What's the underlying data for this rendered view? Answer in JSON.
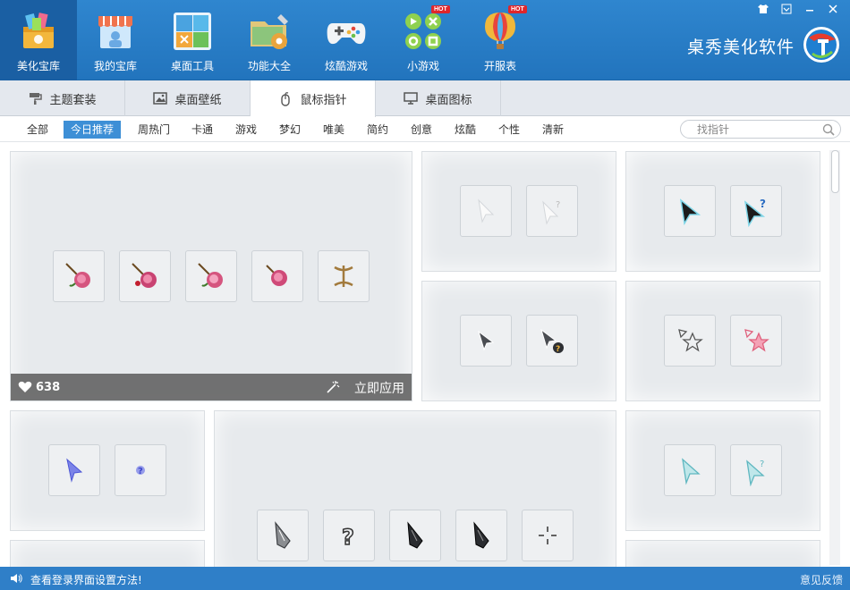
{
  "nav": {
    "items": [
      {
        "label": "美化宝库",
        "icon": "treasure-box-icon",
        "active": true
      },
      {
        "label": "我的宝库",
        "icon": "shop-icon"
      },
      {
        "label": "桌面工具",
        "icon": "desktop-tools-icon"
      },
      {
        "label": "功能大全",
        "icon": "folder-gear-icon"
      },
      {
        "label": "炫酷游戏",
        "icon": "gamepad-icon"
      },
      {
        "label": "小游戏",
        "icon": "mini-game-icon",
        "badge": "HOT"
      },
      {
        "label": "开服表",
        "icon": "balloon-icon",
        "badge": "HOT"
      }
    ]
  },
  "brand": {
    "name": "桌秀美化软件"
  },
  "tabs": [
    {
      "label": "主题套装",
      "icon": "paint-roller-icon"
    },
    {
      "label": "桌面壁纸",
      "icon": "picture-icon"
    },
    {
      "label": "鼠标指针",
      "icon": "mouse-icon",
      "active": true
    },
    {
      "label": "桌面图标",
      "icon": "monitor-icon"
    }
  ],
  "categories": [
    "全部",
    "今日推荐",
    "周热门",
    "卡通",
    "游戏",
    "梦幻",
    "唯美",
    "简约",
    "创意",
    "炫酷",
    "个性",
    "清新"
  ],
  "active_category": "今日推荐",
  "search": {
    "placeholder": "找指针"
  },
  "featured": {
    "likes": "638",
    "apply_label": "立即应用"
  },
  "status": {
    "message": "查看登录界面设置方法!",
    "feedback": "意见反馈"
  },
  "colors": {
    "header": "#2f86cf",
    "active_nav": "#1a5fa3",
    "accent": "#3d8fd6",
    "status": "#2f7fc8"
  }
}
